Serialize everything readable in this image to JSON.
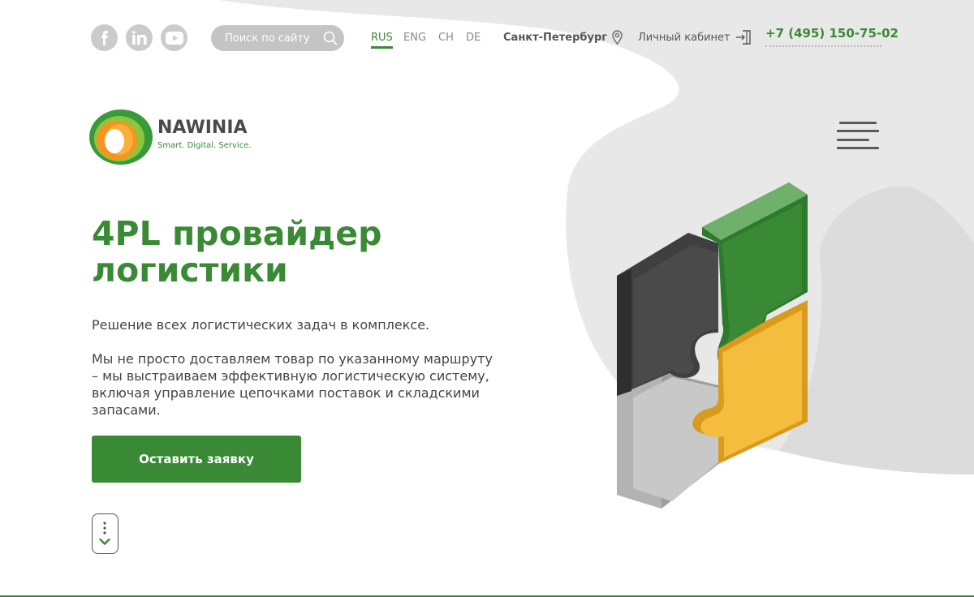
{
  "header": {
    "social": [
      {
        "name": "facebook",
        "icon": "facebook-icon"
      },
      {
        "name": "linkedin",
        "icon": "linkedin-icon"
      },
      {
        "name": "youtube",
        "icon": "youtube-icon"
      }
    ],
    "search": {
      "placeholder": "Поиск по сайту",
      "icon": "search-icon"
    },
    "languages": [
      {
        "label": "RUS",
        "active": true
      },
      {
        "label": "ENG",
        "active": false
      },
      {
        "label": "CH",
        "active": false
      },
      {
        "label": "DE",
        "active": false
      }
    ],
    "city": {
      "label": "Санкт-Петербург",
      "icon": "location-pin-icon"
    },
    "cabinet": {
      "label": "Личный кабинет",
      "icon": "login-icon"
    },
    "phone": "+7 (495) 150-75-02"
  },
  "logo": {
    "name": "NAWINIA",
    "tagline": "Smart. Digital. Service."
  },
  "hero": {
    "title": "4PL провайдер логистики",
    "lead": "Решение всех логистических задач в комплексе.",
    "description": "Мы не просто доставляем товар по указанному маршруту – мы выстраиваем эффективную логистическую систему, включая управление цепочками поставок и складскими запасами.",
    "cta_label": "Оставить заявку"
  },
  "colors": {
    "accent": "#3a8a35",
    "puzzle_dark": "#4a4a4a",
    "puzzle_green": "#3a8a35",
    "puzzle_yellow": "#f4bd3d",
    "puzzle_gray": "#bdbdbd"
  }
}
